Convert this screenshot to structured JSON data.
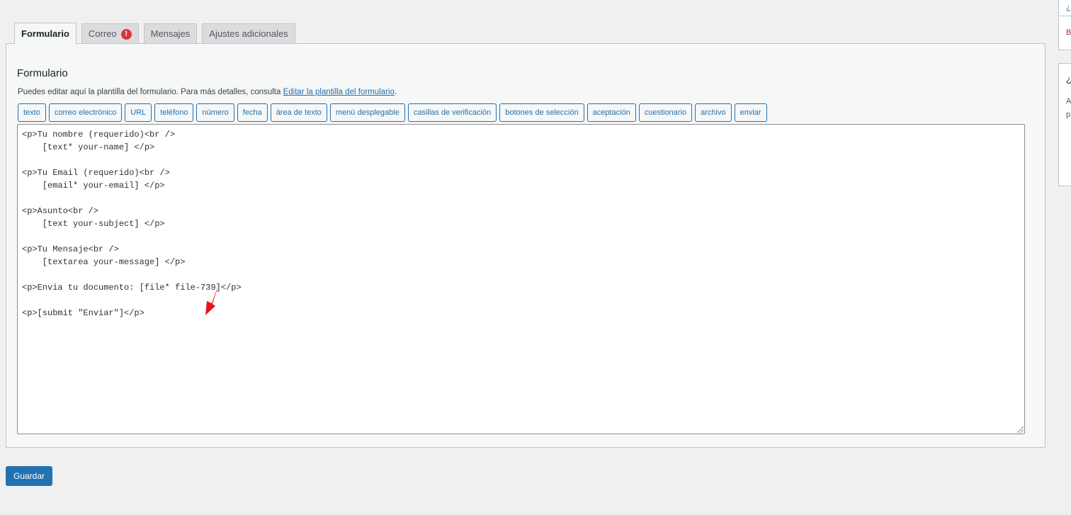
{
  "tabs": [
    {
      "label": "Formulario",
      "active": true
    },
    {
      "label": "Correo",
      "badge": "!"
    },
    {
      "label": "Mensajes"
    },
    {
      "label": "Ajustes adicionales"
    }
  ],
  "panel": {
    "title": "Formulario",
    "description_prefix": "Puedes editar aquí la plantilla del formulario. Para más detalles, consulta ",
    "description_link": "Editar la plantilla del formulario",
    "description_suffix": "."
  },
  "tag_buttons": [
    "texto",
    "correo electrónico",
    "URL",
    "teléfono",
    "número",
    "fecha",
    "área de texto",
    "menú desplegable",
    "casillas de verificación",
    "botones de selección",
    "aceptación",
    "cuestionario",
    "archivo",
    "enviar"
  ],
  "editor": {
    "content": "<p>Tu nombre (requerido)<br />\n    [text* your-name] </p>\n\n<p>Tu Email (requerido)<br />\n    [email* your-email] </p>\n\n<p>Asunto<br />\n    [text your-subject] </p>\n\n<p>Tu Mensaje<br />\n    [textarea your-message] </p>\n\n<p>Envia tu documento: [file* file-739]</p>\n\n<p>[submit \"Enviar\"]</p>"
  },
  "save_label": "Guardar",
  "sidebar": {
    "box1_top": "¿C",
    "box1_bottom": "B",
    "box2_title": "¿",
    "box2_line1": "A",
    "box2_line2": "p"
  },
  "colors": {
    "accent": "#2271b1",
    "badge": "#d63638",
    "arrow": "#e8141c",
    "background": "#f0f0f1"
  }
}
